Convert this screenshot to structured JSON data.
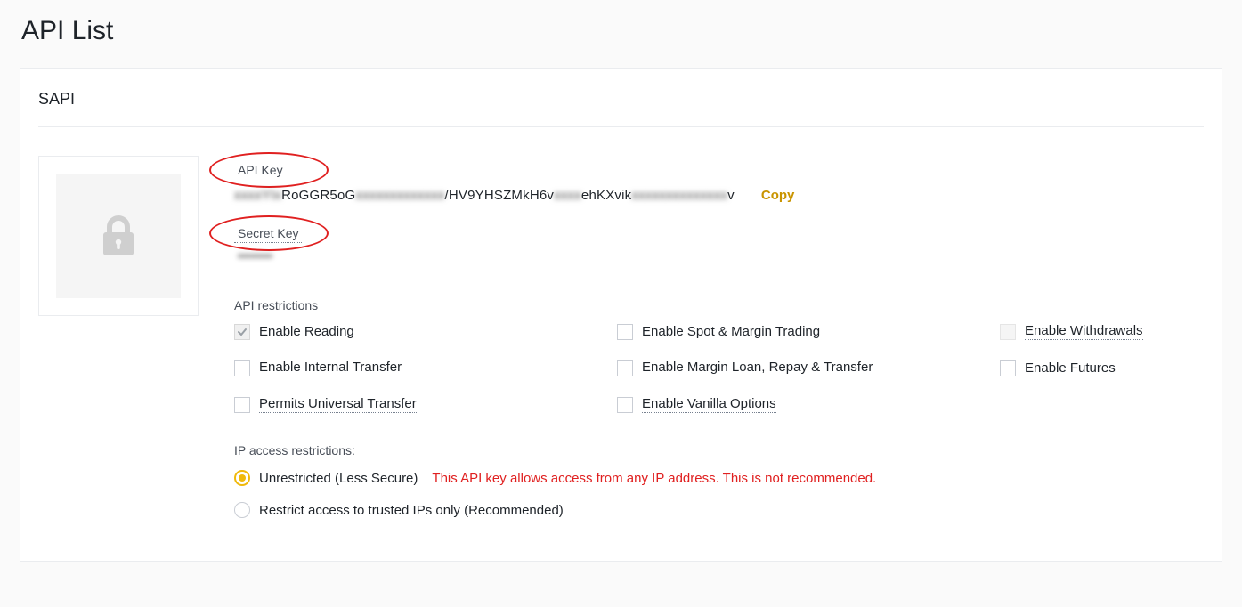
{
  "page": {
    "title": "API List"
  },
  "card": {
    "name": "SAPI",
    "api_key": {
      "label": "API Key",
      "value_visible_parts": [
        "RoGGR5oG",
        "/HV9YHSZMkH6v",
        "ehKXvik",
        "v"
      ],
      "copy_label": "Copy"
    },
    "secret_key": {
      "label": "Secret Key",
      "value_hidden": "••••••••"
    },
    "restrictions": {
      "title": "API restrictions",
      "items": [
        {
          "id": "reading",
          "label": "Enable Reading",
          "checked": true,
          "locked": true,
          "underlined": false
        },
        {
          "id": "spot_margin",
          "label": "Enable Spot & Margin Trading",
          "checked": false,
          "locked": false,
          "underlined": false
        },
        {
          "id": "withdrawals",
          "label": "Enable Withdrawals",
          "checked": false,
          "locked": true,
          "underlined": true
        },
        {
          "id": "internal_transfer",
          "label": "Enable Internal Transfer",
          "checked": false,
          "locked": false,
          "underlined": true
        },
        {
          "id": "margin_loan",
          "label": "Enable Margin Loan, Repay & Transfer",
          "checked": false,
          "locked": false,
          "underlined": true
        },
        {
          "id": "futures",
          "label": "Enable Futures",
          "checked": false,
          "locked": false,
          "underlined": false
        },
        {
          "id": "universal",
          "label": "Permits Universal Transfer",
          "checked": false,
          "locked": false,
          "underlined": true
        },
        {
          "id": "vanilla",
          "label": "Enable Vanilla Options",
          "checked": false,
          "locked": false,
          "underlined": true
        }
      ]
    },
    "ip": {
      "title": "IP access restrictions:",
      "options": [
        {
          "id": "unrestricted",
          "label": "Unrestricted (Less Secure)",
          "selected": true,
          "warning": "This API key allows access from any IP address. This is not recommended."
        },
        {
          "id": "trusted",
          "label": "Restrict access to trusted IPs only (Recommended)",
          "selected": false,
          "warning": ""
        }
      ]
    }
  },
  "colors": {
    "accent": "#f0b90b",
    "danger": "#e02020"
  }
}
